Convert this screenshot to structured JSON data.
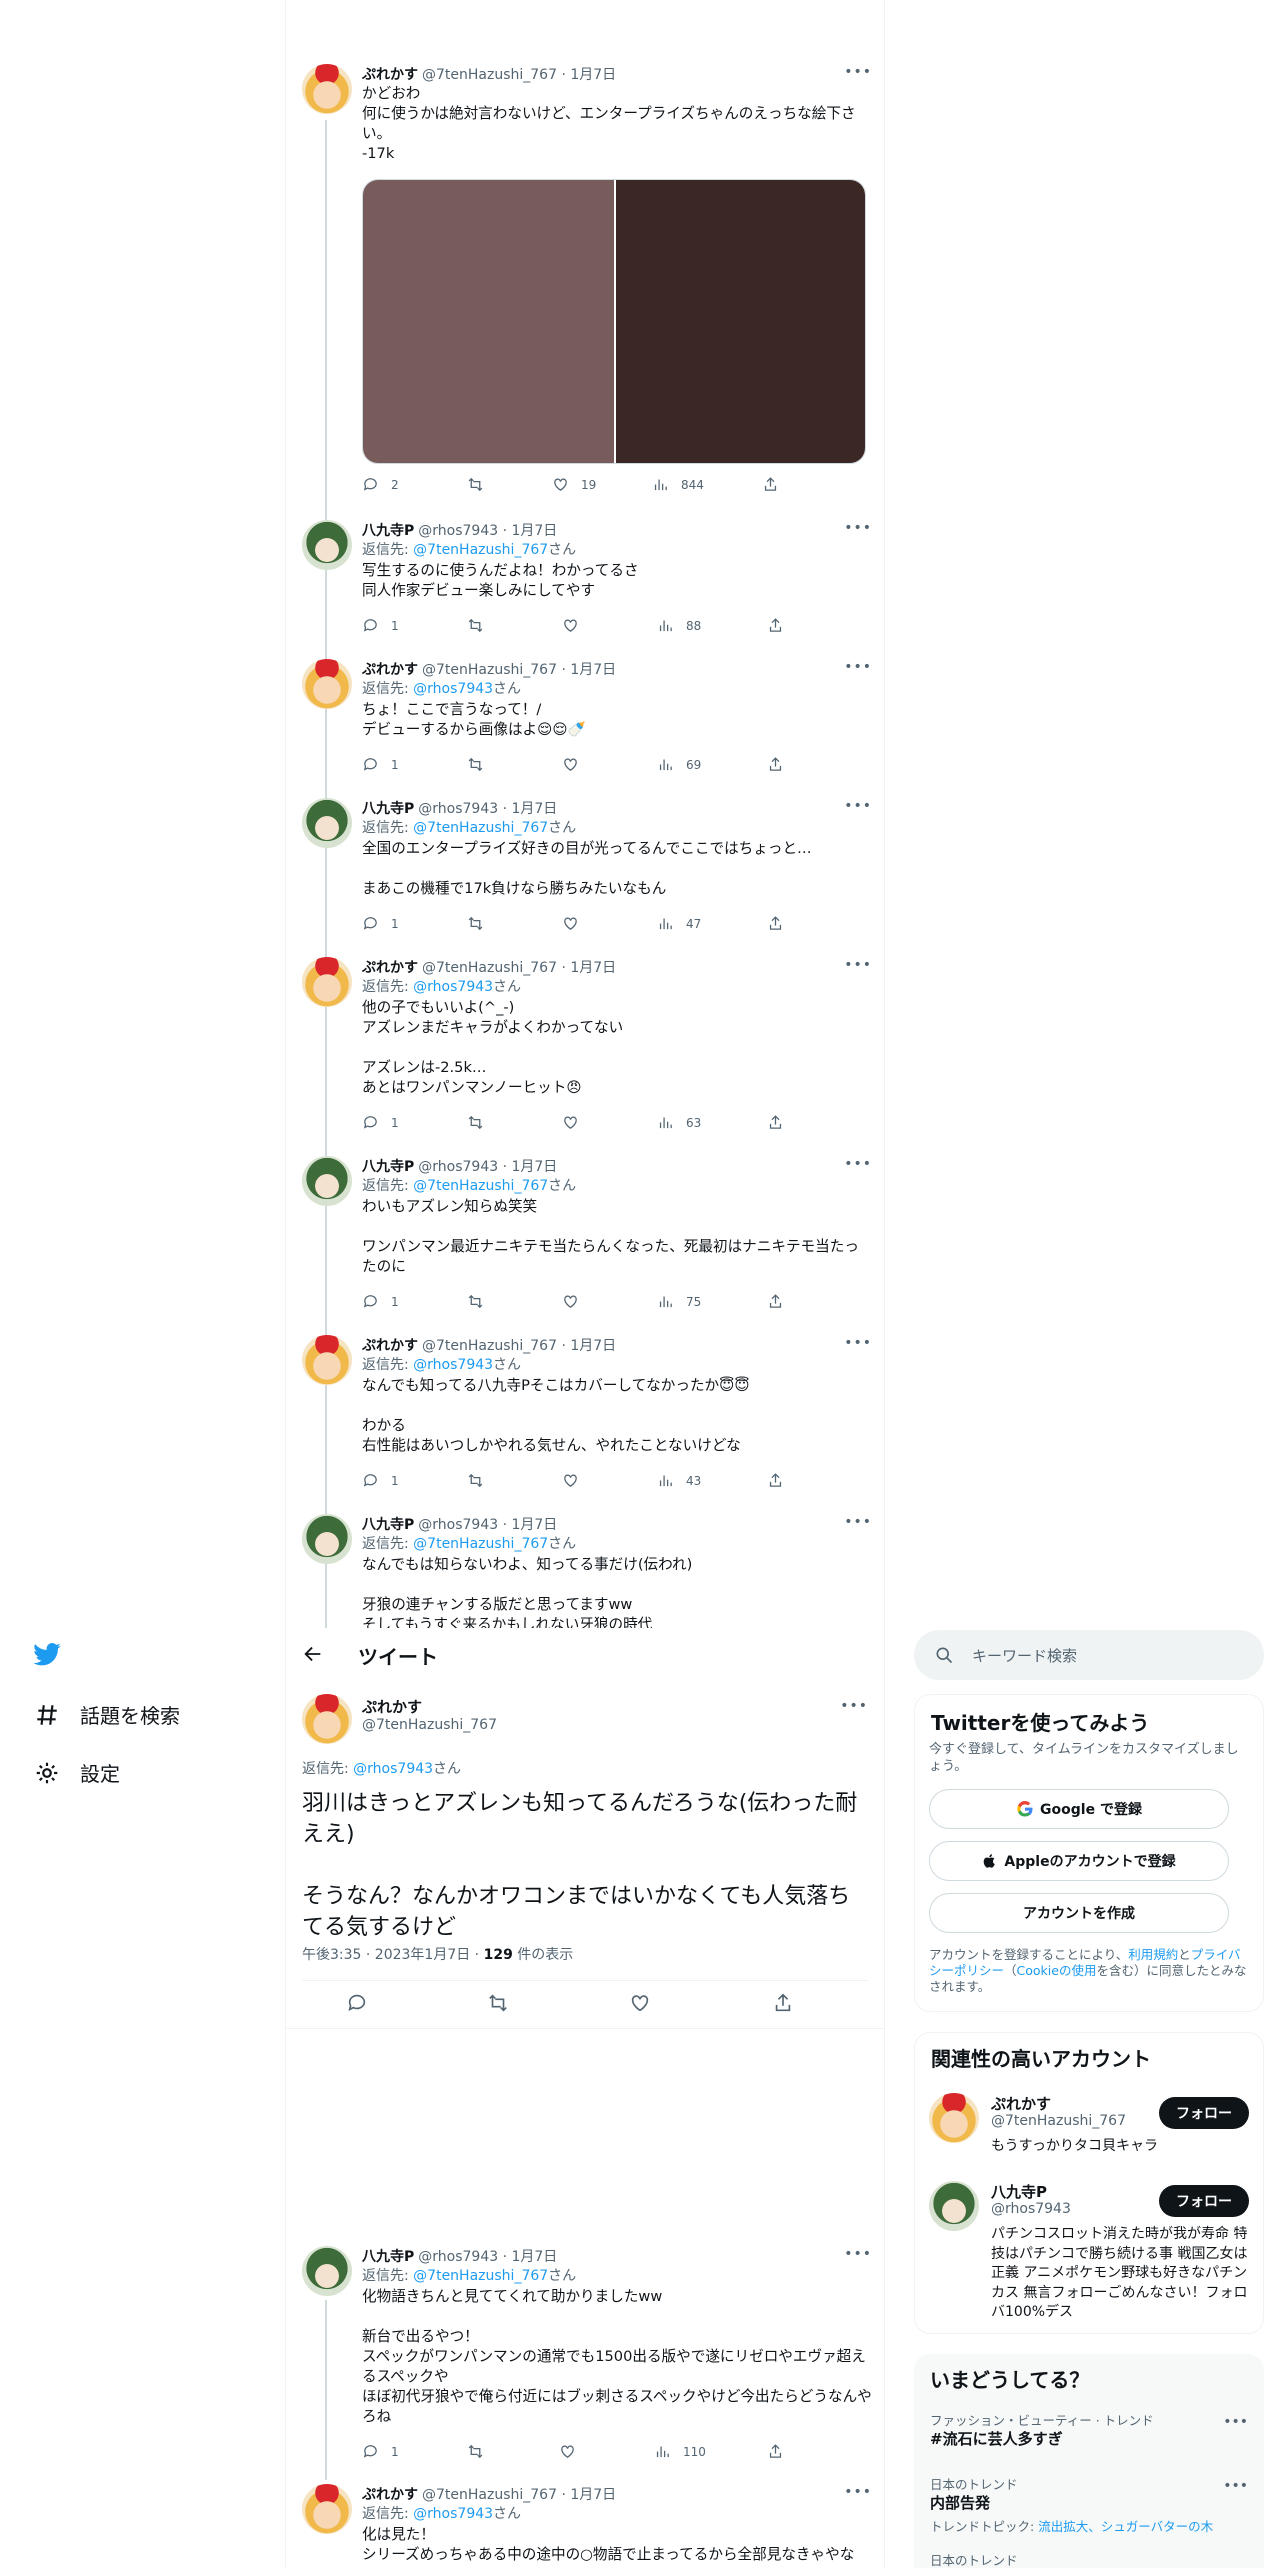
{
  "colors": {
    "accent": "#1d9bf0",
    "text": "#0f1419",
    "muted": "#536471",
    "border": "#eff3f4"
  },
  "thread": [
    {
      "avatar": "a",
      "name": "ぷれかす",
      "meta": "@7tenHazushi_767 · 1月7日",
      "reply_to": "",
      "text": "かどおわ\n何に使うかは絶対言わないけど、エンタープライズちゃんのえっちな絵下さい。\n-17k",
      "stats": {
        "reply": "2",
        "retweet": "",
        "like": "19",
        "views": "844"
      }
    },
    {
      "avatar": "b",
      "name": "八九寺P",
      "meta": "@rhos7943 · 1月7日",
      "reply_to": "@7tenHazushi_767",
      "text": "写生するのに使うんだよね！わかってるさ\n同人作家デビュー楽しみにしてやす",
      "stats": {
        "reply": "1",
        "retweet": "",
        "like": "",
        "views": "88"
      }
    },
    {
      "avatar": "a",
      "name": "ぷれかす",
      "meta": "@7tenHazushi_767 · 1月7日",
      "reply_to": "@rhos7943",
      "text": "ちょ！ここで言うなって！/\nデビューするから画像はよ😌😌🍼",
      "stats": {
        "reply": "1",
        "retweet": "",
        "like": "",
        "views": "69"
      }
    },
    {
      "avatar": "b",
      "name": "八九寺P",
      "meta": "@rhos7943 · 1月7日",
      "reply_to": "@7tenHazushi_767",
      "text": "全国のエンタープライズ好きの目が光ってるんでここではちょっと…\n\nまあこの機種で17k負けなら勝ちみたいなもん",
      "stats": {
        "reply": "1",
        "retweet": "",
        "like": "",
        "views": "47"
      }
    },
    {
      "avatar": "a",
      "name": "ぷれかす",
      "meta": "@7tenHazushi_767 · 1月7日",
      "reply_to": "@rhos7943",
      "text": "他の子でもいいよ(^_-)\nアズレンまだキャラがよくわかってない\n\nアズレンは-2.5k…\nあとはワンパンマンノーヒット😠",
      "stats": {
        "reply": "1",
        "retweet": "",
        "like": "",
        "views": "63"
      }
    },
    {
      "avatar": "b",
      "name": "八九寺P",
      "meta": "@rhos7943 · 1月7日",
      "reply_to": "@7tenHazushi_767",
      "text": "わいもアズレン知らぬ笑笑\n\nワンパンマン最近ナニキテモ当たらんくなった、死最初はナニキテモ当たったのに",
      "stats": {
        "reply": "1",
        "retweet": "",
        "like": "",
        "views": "75"
      }
    },
    {
      "avatar": "a",
      "name": "ぷれかす",
      "meta": "@7tenHazushi_767 · 1月7日",
      "reply_to": "@rhos7943",
      "text": "なんでも知ってる八九寺Pそこはカバーしてなかったか😇😇\n\nわかる\n右性能はあいつしかやれる気せん、やれたことないけどな",
      "stats": {
        "reply": "1",
        "retweet": "",
        "like": "",
        "views": "43"
      }
    },
    {
      "avatar": "b",
      "name": "八九寺P",
      "meta": "@rhos7943 · 1月7日",
      "reply_to": "@7tenHazushi_767",
      "text": "なんでもは知らないわよ、知ってる事だけ(伝われ)\n\n牙狼の連チャンする版だと思ってますww\nそしてもうすぐ来るかもしれない牙狼の時代",
      "stats": {
        "reply": "",
        "retweet": "",
        "like": "",
        "views": ""
      }
    }
  ],
  "reply_prefix": "返信先:",
  "reply_suffix": "さん",
  "nav": {
    "explore": "話題を検索",
    "settings": "設定"
  },
  "header": {
    "title": "ツイート"
  },
  "main_tweet": {
    "name": "ぷれかす",
    "handle": "@7tenHazushi_767",
    "reply_to": "@rhos7943",
    "text": "羽川はきっとアズレンも知ってるんだろうな(伝わった耐ええ)\n\nそうなん？なんかオワコンまではいかなくても人気落ちてる気するけど",
    "time": "午後3:35 · 2023年1月7日 · ",
    "views_count": "129",
    "views_label": " 件の表示"
  },
  "replies": [
    {
      "avatar": "b",
      "name": "八九寺P",
      "meta": "@rhos7943 · 1月7日",
      "reply_to": "@7tenHazushi_767",
      "text": "化物語きちんと見ててくれて助かりましたww\n\n新台で出るやつ！\nスペックがワンパンマンの通常でも1500出る版やで遂にリゼロやエヴァ超えるスペックや\nほぼ初代牙狼やで俺ら付近にはブッ刺さるスペックやけど今出たらどうなんやろね",
      "stats": {
        "reply": "1",
        "retweet": "",
        "like": "",
        "views": "110"
      }
    },
    {
      "avatar": "a",
      "name": "ぷれかす",
      "meta": "@7tenHazushi_767 · 1月7日",
      "reply_to": "@rhos7943",
      "text": "化は見た！\nシリーズめっちゃある中の途中の○物語で止まってるから全部見なきゃやな",
      "stats": {
        "reply": "",
        "retweet": "",
        "like": "",
        "views": ""
      }
    }
  ],
  "search": {
    "placeholder": "キーワード検索"
  },
  "signup": {
    "title": "Twitterを使ってみよう",
    "subtitle": "今すぐ登録して、タイムラインをカスタマイズしましょう。",
    "google": "Google で登録",
    "apple": "Appleのアカウントで登録",
    "create": "アカウントを作成",
    "legal_1": "アカウントを登録することにより、",
    "legal_terms": "利用規約",
    "legal_2": "と",
    "legal_privacy": "プライバシーポリシー",
    "legal_3": "（",
    "legal_cookie": "Cookieの使用",
    "legal_4": "を含む）に同意したとみなされます。"
  },
  "relevant": {
    "title": "関連性の高いアカウント",
    "follow_label": "フォロー",
    "accounts": [
      {
        "avatar": "a",
        "name": "ぷれかす",
        "handle": "@7tenHazushi_767",
        "bio": "もうすっかりタコ貝キャラ"
      },
      {
        "avatar": "b",
        "name": "八九寺P",
        "handle": "@rhos7943",
        "bio": "パチンコスロット消えた時が我が寿命 特技はパチンコで勝ち続ける事 戦国乙女は正義 アニメポケモン野球も好きなパチンカス 無言フォローごめんなさい！フォロバ100%デス"
      }
    ]
  },
  "trends": {
    "title": "いまどうしてる？",
    "items": [
      {
        "category": "ファッション・ビューティー · トレンド",
        "name": "#流石に芸人多すぎ",
        "extra_prefix": "",
        "extra_links": ""
      },
      {
        "category": "日本のトレンド",
        "name": "内部告発",
        "extra_prefix": "トレンドトピック: ",
        "extra_links": "流出拡大、シュガーバターの木"
      },
      {
        "category": "日本のトレンド",
        "name": "",
        "extra_prefix": "",
        "extra_links": ""
      }
    ]
  }
}
